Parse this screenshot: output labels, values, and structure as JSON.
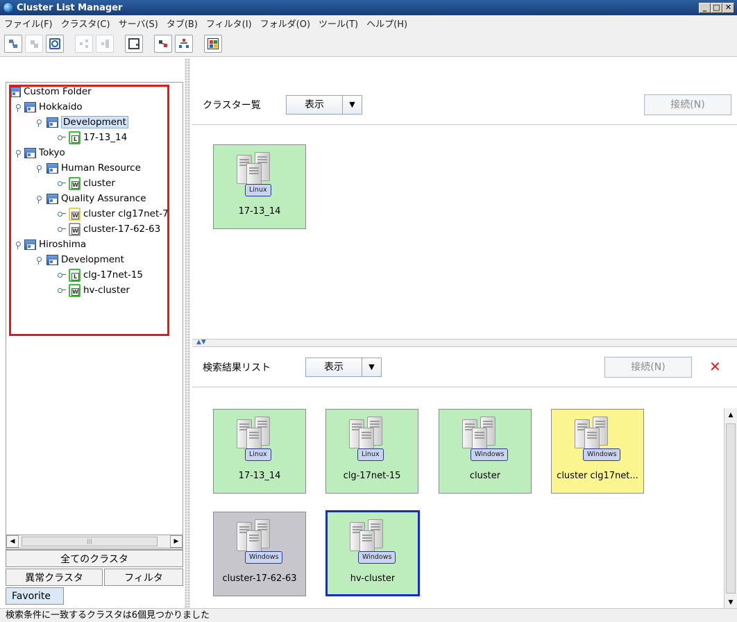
{
  "window": {
    "title": "Cluster List Manager",
    "min_label": "_",
    "max_label": "□",
    "close_label": "✕"
  },
  "menu": [
    "ファイル(F)",
    "クラスタ(C)",
    "サーバ(S)",
    "タブ(B)",
    "フィルタ(I)",
    "フォルダ(O)",
    "ツール(T)",
    "ヘルプ(H)"
  ],
  "toolbar_icons": [
    "add-cluster-icon",
    "remove-cluster-icon",
    "search-icon",
    "link-icon",
    "unlink-icon",
    "export-icon",
    "server-icon",
    "network-icon",
    "color-palette-icon"
  ],
  "tree": {
    "root": "Custom Folder",
    "hokkaido": "Hokkaido",
    "hokkaido_dev": "Development",
    "c_17_13_14": "17-13_14",
    "tokyo": "Tokyo",
    "human_resource": "Human Resource",
    "c_cluster": "cluster",
    "qa": "Quality Assurance",
    "c_clg17net_7": "cluster clg17net-7",
    "c_17_62_63": "cluster-17-62-63",
    "hiroshima": "Hiroshima",
    "hiroshima_dev": "Development",
    "c_clg_17net_15": "clg-17net-15",
    "c_hv_cluster": "hv-cluster",
    "letter_L": "L",
    "letter_W": "W"
  },
  "left_tabs": {
    "all": "全てのクラスタ",
    "abnormal": "異常クラスタ",
    "filter": "フィルタ",
    "favorite": "Favorite"
  },
  "scroll_thumb": "|||",
  "top_panel": {
    "title": "クラスター覧",
    "view": "表示",
    "connect": "接続(N)",
    "arrow": "▼"
  },
  "bottom_panel": {
    "title": "検索結果リスト",
    "view": "表示",
    "connect": "接続(N)",
    "close": "✕",
    "arrow": "▼"
  },
  "split_arrows": "▲▼",
  "top_cards": [
    {
      "label": "17-13_14",
      "os": "Linux",
      "color": "green"
    }
  ],
  "result_cards": [
    {
      "label": "17-13_14",
      "os": "Linux",
      "color": "green"
    },
    {
      "label": "clg-17net-15",
      "os": "Linux",
      "color": "green"
    },
    {
      "label": "cluster",
      "os": "Windows",
      "color": "green"
    },
    {
      "label": "cluster clg17net...",
      "os": "Windows",
      "color": "yellow"
    },
    {
      "label": "cluster-17-62-63",
      "os": "Windows",
      "color": "gray"
    },
    {
      "label": "hv-cluster",
      "os": "Windows",
      "color": "green",
      "selected": true
    }
  ],
  "status": "検索条件に一致するクラスタは6個見つかりました",
  "colors": {
    "selected_border": "#1429d6",
    "annotation_red": "#e21a1a",
    "card_green": "#bdecbd",
    "card_yellow": "#faf58e",
    "card_gray": "#c7c6cc"
  }
}
